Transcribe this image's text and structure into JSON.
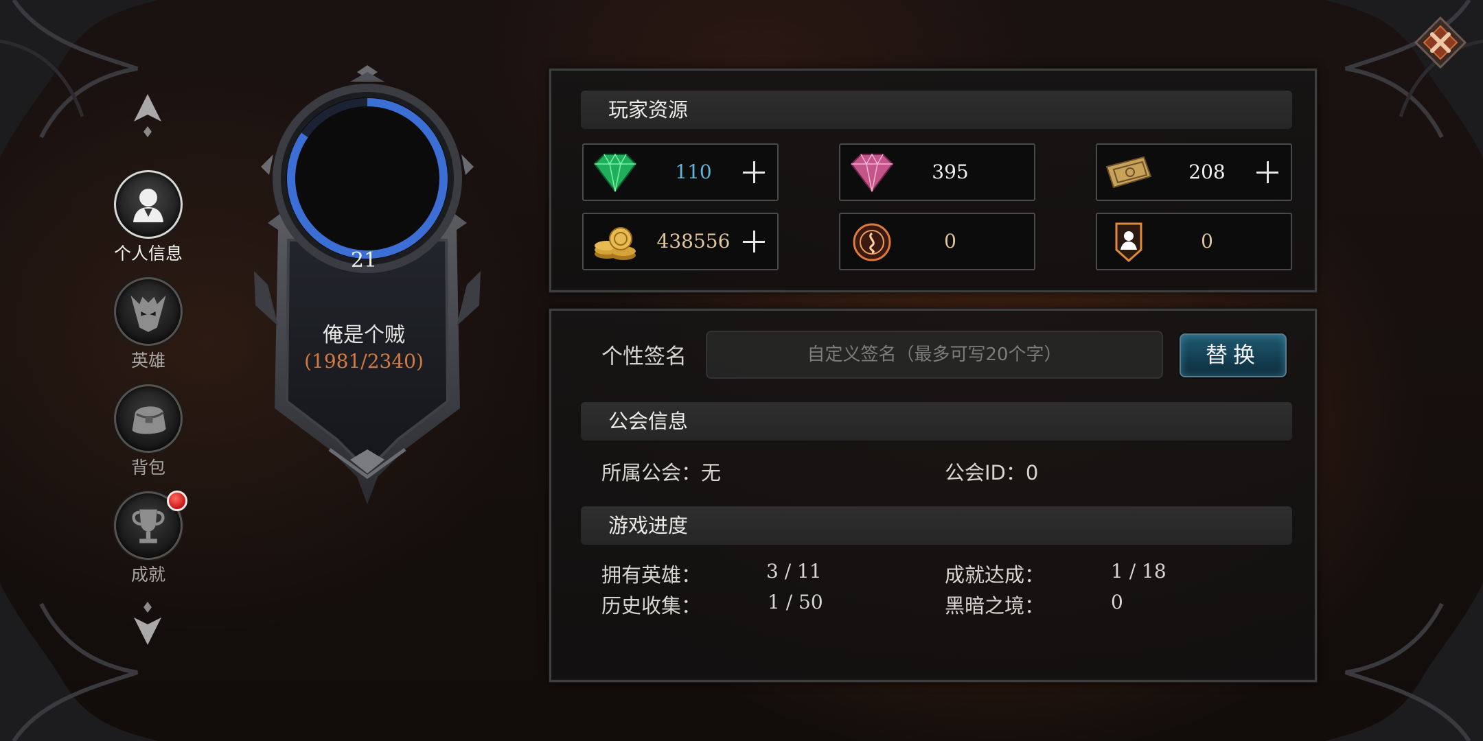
{
  "nav": {
    "items": [
      {
        "label": "个人信息",
        "icon": "person-icon",
        "active": true
      },
      {
        "label": "英雄",
        "icon": "demon-helmet-icon",
        "active": false
      },
      {
        "label": "背包",
        "icon": "bag-icon",
        "active": false
      },
      {
        "label": "成就",
        "icon": "trophy-icon",
        "active": false,
        "badge": true
      }
    ]
  },
  "profile": {
    "level": "21",
    "name": "俺是个贼",
    "exp": "(1981/2340)",
    "exp_progress": 0.846
  },
  "resources": {
    "title": "玩家资源",
    "items": [
      {
        "icon": "emerald-gem-icon",
        "value": "110",
        "color": "#5fb6d8",
        "plus": true
      },
      {
        "icon": "pink-diamond-icon",
        "value": "395",
        "color": "#f2f2f2",
        "plus": false
      },
      {
        "icon": "ticket-icon",
        "value": "208",
        "color": "#f2f2f2",
        "plus": true
      },
      {
        "icon": "gold-coins-icon",
        "value": "438556",
        "color": "#e0c79a",
        "plus": true
      },
      {
        "icon": "rune-seal-icon",
        "value": "0",
        "color": "#e0c79a",
        "plus": false
      },
      {
        "icon": "hero-token-icon",
        "value": "0",
        "color": "#e0c79a",
        "plus": false
      }
    ]
  },
  "signature": {
    "label": "个性签名",
    "placeholder": "自定义签名（最多可写20个字）",
    "button": "替换"
  },
  "guild": {
    "title": "公会信息",
    "guild_label": "所属公会：无",
    "guild_id_label": "公会ID：0"
  },
  "progress": {
    "title": "游戏进度",
    "stats": [
      {
        "label": "拥有英雄：",
        "value": "3 / 11"
      },
      {
        "label": "成就达成：",
        "value": "1 / 18"
      },
      {
        "label": "历史收集：",
        "value": "1 / 50"
      },
      {
        "label": "黑暗之境：",
        "value": "0"
      }
    ]
  },
  "colors": {
    "accent_blue": "#3c6fd6",
    "exp_orange": "#d67a42",
    "badge_red": "#d0181d"
  }
}
